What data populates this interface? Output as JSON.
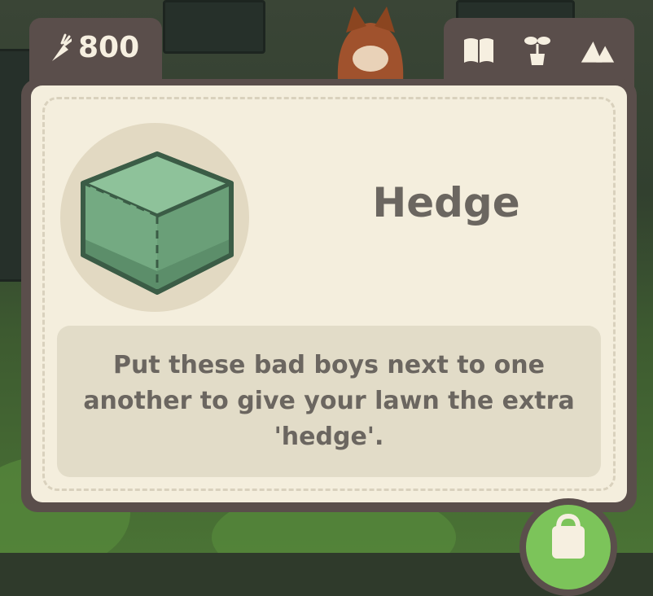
{
  "hud": {
    "currency_icon": "carrot-icon",
    "currency_value": "800",
    "tabs": [
      {
        "icon": "book-icon"
      },
      {
        "icon": "plant-icon"
      },
      {
        "icon": "mountain-icon"
      }
    ]
  },
  "item": {
    "name": "Hedge",
    "image_icon": "hedge-cube-icon",
    "description": "Put these bad boys next to one another to give your lawn the extra 'hedge'."
  },
  "shop_button": {
    "icon": "shopping-bag-icon"
  },
  "colors": {
    "panel_frame": "#5a4e4b",
    "panel_bg": "#f4eedd",
    "text": "#6b6660",
    "accent_green": "#7cc45a"
  }
}
